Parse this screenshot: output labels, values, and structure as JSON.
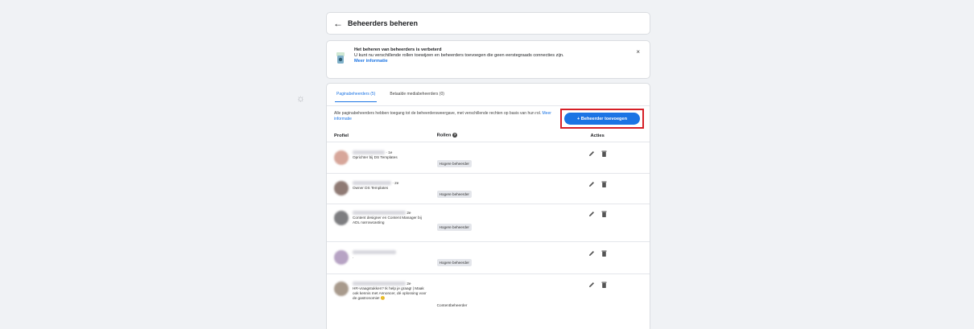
{
  "header": {
    "back_glyph": "←",
    "title": "Beheerders beheren"
  },
  "notice": {
    "heading": "Het beheren van beheerders is verbeterd",
    "body": "U kunt nu verschillende rollen toewijzen en beheerders toevoegen die geen eerstegraads connecties zijn.",
    "link": "Meer informatie",
    "close_glyph": "×"
  },
  "tabs": [
    {
      "label": "Paginabeheerders (5)",
      "active": true
    },
    {
      "label": "Betaalde mediabeheerders (0)",
      "active": false
    }
  ],
  "description": {
    "text": "Alle paginabeheerders hebben toegang tot de beheerdersweergave, met verschillende rechten op basis van hun rol.",
    "link": "Meer informatie"
  },
  "add_button": {
    "label": "+ Beheerder toevoegen"
  },
  "columns": {
    "profile": "Profiel",
    "roles": "Rollen",
    "actions": "Acties"
  },
  "rows": [
    {
      "degree": "· 1e",
      "subtitle": "Oprichter bij DS Templates",
      "role": "Hogere beheerder",
      "role_badge": true
    },
    {
      "degree": "· 2e",
      "subtitle": "Owner DS Templates",
      "role": "Hogere beheerder",
      "role_badge": true
    },
    {
      "degree": "2e",
      "subtitle": "Content designer en Content Manager bij ADL narrowcasting",
      "role": "Hogere beheerder",
      "role_badge": true
    },
    {
      "degree": "",
      "subtitle": ".",
      "role": "Hogere beheerder",
      "role_badge": true
    },
    {
      "degree": "2e",
      "subtitle": "HR-vraagstukken? Ik help je graag! | Maak ook kennis met Annoncer, dé oplossing voor de gastronomie! 😊",
      "role": "Contentbeheerder",
      "role_badge": false
    }
  ],
  "colors": {
    "accent": "#1b74e4",
    "highlight": "#d61f27"
  }
}
